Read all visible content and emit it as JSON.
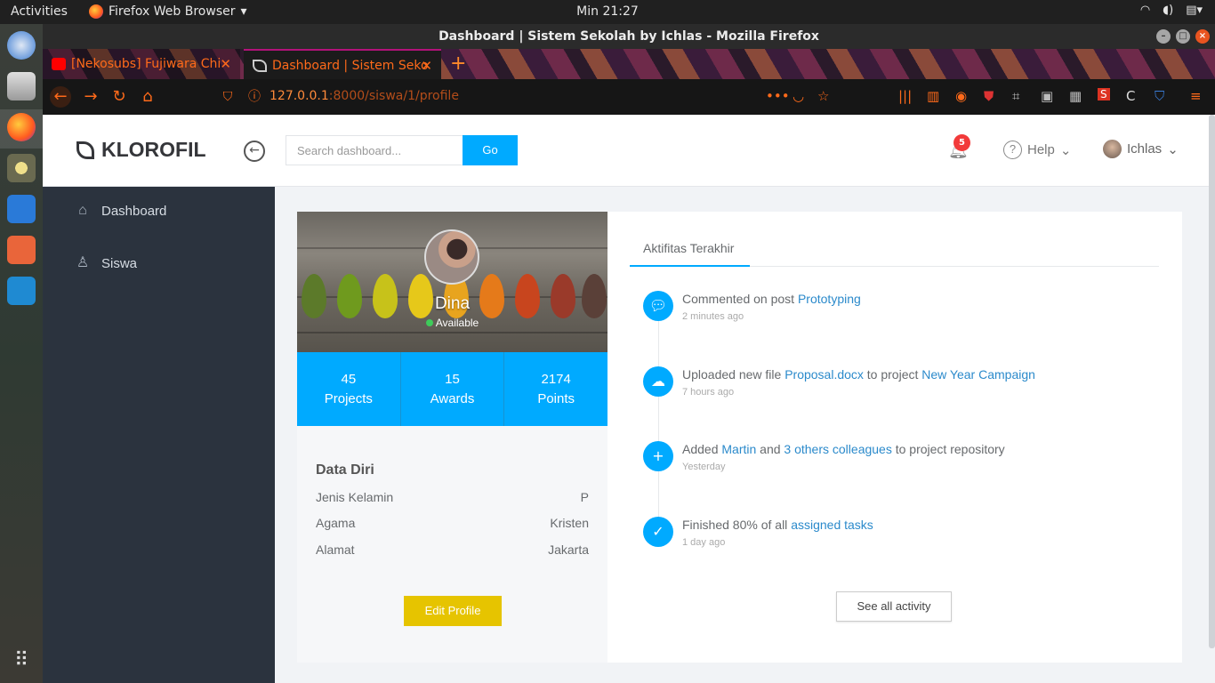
{
  "system": {
    "activities": "Activities",
    "app_name": "Firefox Web Browser",
    "clock": "Min 21:27"
  },
  "window": {
    "title": "Dashboard | Sistem Sekolah by Ichlas - Mozilla Firefox"
  },
  "tabs": [
    {
      "title": "[Nekosubs] Fujiwara Chi"
    },
    {
      "title": "Dashboard | Sistem Seko"
    }
  ],
  "address": {
    "host": "127.0.0.1",
    "rest": ":8000/siswa/1/profile"
  },
  "header": {
    "brand": "KLOROFIL",
    "search_placeholder": "Search dashboard...",
    "go_label": "Go",
    "notif_count": "5",
    "help_label": "Help",
    "user_label": "Ichlas"
  },
  "sidebar": {
    "items": [
      {
        "label": "Dashboard"
      },
      {
        "label": "Siswa"
      }
    ]
  },
  "profile": {
    "name": "Dina",
    "status": "Available",
    "stats": [
      {
        "value": "45",
        "label": "Projects"
      },
      {
        "value": "15",
        "label": "Awards"
      },
      {
        "value": "2174",
        "label": "Points"
      }
    ],
    "section_title": "Data Diri",
    "details": [
      {
        "key": "Jenis Kelamin",
        "value": "P"
      },
      {
        "key": "Agama",
        "value": "Kristen"
      },
      {
        "key": "Alamat",
        "value": "Jakarta"
      }
    ],
    "edit_label": "Edit Profile"
  },
  "activity": {
    "tab_label": "Aktifitas Terakhir",
    "items": [
      {
        "t1": "Commented on post ",
        "l1": "Prototyping",
        "t2": "",
        "l2": "",
        "t3": "",
        "time": "2 minutes ago"
      },
      {
        "t1": "Uploaded new file ",
        "l1": "Proposal.docx",
        "t2": " to project ",
        "l2": "New Year Campaign",
        "t3": "",
        "time": "7 hours ago"
      },
      {
        "t1": "Added ",
        "l1": "Martin",
        "t2": " and ",
        "l2": "3 others colleagues",
        "t3": " to project repository",
        "time": "Yesterday"
      },
      {
        "t1": "Finished 80% of all ",
        "l1": "assigned tasks",
        "t2": "",
        "l2": "",
        "t3": "",
        "time": "1 day ago"
      }
    ],
    "see_all_label": "See all activity"
  }
}
